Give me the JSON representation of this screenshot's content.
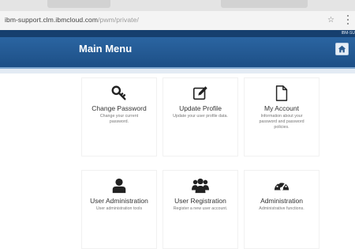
{
  "browser": {
    "url_host": "ibm-support.clm.ibmcloud.com",
    "url_path": "/pwm/private/",
    "star_icon": "star-icon"
  },
  "header": {
    "user_label": "IBM-SU",
    "title": "Main Menu",
    "home_icon": "home-icon",
    "colors": {
      "header": "#2563a0",
      "band": "#163f6e"
    }
  },
  "menu": {
    "tiles": [
      {
        "icon": "key-icon",
        "title": "Change Password",
        "description": "Change your current password."
      },
      {
        "icon": "edit-icon",
        "title": "Update Profile",
        "description": "Update your user profile data."
      },
      {
        "icon": "document-icon",
        "title": "My Account",
        "description": "Information about your password and password policies."
      },
      {
        "icon": "user-icon",
        "title": "User Administration",
        "description": "User administration tools"
      },
      {
        "icon": "users-icon",
        "title": "User Registration",
        "description": "Register a new user account."
      },
      {
        "icon": "dashboard-icon",
        "title": "Administration",
        "description": "Administrative functions."
      }
    ]
  }
}
